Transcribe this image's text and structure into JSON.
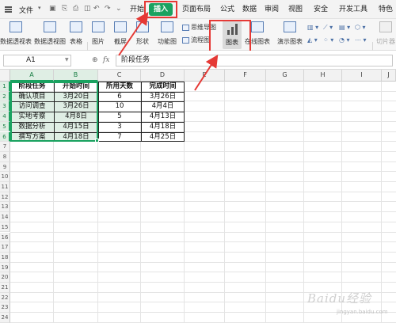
{
  "menubar": {
    "file_label": "文件",
    "tabs": [
      "开始",
      "插入",
      "页面布局",
      "公式",
      "数据",
      "审阅",
      "视图",
      "安全",
      "开发工具",
      "特色功"
    ],
    "active_tab": "插入"
  },
  "ribbon": {
    "buttons": [
      "数据透视表",
      "数据透视图",
      "表格",
      "图片",
      "截屏",
      "形状",
      "功能图",
      "图表",
      "在线图表",
      "演示图表"
    ],
    "small_buttons": [
      "思维导图",
      "流程图"
    ],
    "right_label": "切片器",
    "highlighted": "图表"
  },
  "formula_bar": {
    "cell_ref": "A1",
    "fx_label": "fx",
    "content": "阶段任务"
  },
  "grid": {
    "columns": [
      "A",
      "B",
      "C",
      "D",
      "E",
      "F",
      "G",
      "H",
      "I",
      "J"
    ],
    "rows": [
      "1",
      "2",
      "3",
      "4",
      "5",
      "6",
      "7",
      "8",
      "9",
      "10",
      "11",
      "12",
      "13",
      "14",
      "15",
      "16",
      "17",
      "18",
      "19",
      "20",
      "21",
      "22",
      "23",
      "24"
    ],
    "table": {
      "headers": [
        "阶段任务",
        "开始时间",
        "所用天数",
        "完成时间"
      ],
      "rows": [
        [
          "确认项目",
          "3月20日",
          "6",
          "3月26日"
        ],
        [
          "访问调查",
          "3月26日",
          "10",
          "4月4日"
        ],
        [
          "实地考察",
          "4月8日",
          "5",
          "4月13日"
        ],
        [
          "数据分析",
          "4月15日",
          "3",
          "4月18日"
        ],
        [
          "撰写方案",
          "4月18日",
          "7",
          "4月25日"
        ]
      ]
    }
  },
  "colors": {
    "accent": "#1aa260",
    "annotation": "#e53935"
  },
  "watermark": {
    "text": "Baidu经验",
    "sub": "jingyan.baidu.com"
  }
}
